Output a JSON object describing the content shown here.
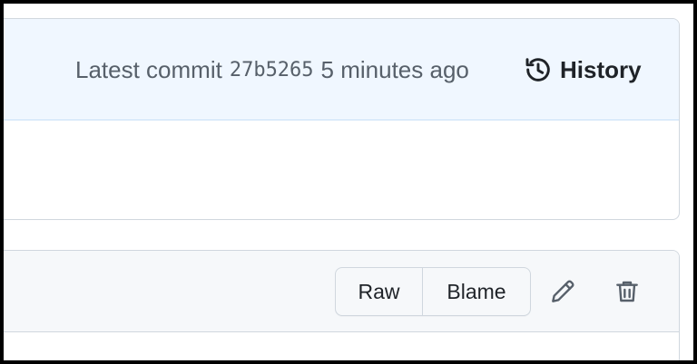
{
  "commit": {
    "prefix": "Latest commit",
    "sha": "27b5265",
    "time": "5 minutes ago",
    "history_label": "History",
    "history_icon": "history-icon"
  },
  "file_toolbar": {
    "raw_label": "Raw",
    "blame_label": "Blame",
    "edit_icon": "pencil-icon",
    "delete_icon": "trash-icon"
  },
  "colors": {
    "commit_header_bg": "#f0f7ff",
    "file_header_bg": "#f6f8fa",
    "border": "#d0d7de",
    "muted_text": "#57606a",
    "primary_text": "#1f2328"
  }
}
